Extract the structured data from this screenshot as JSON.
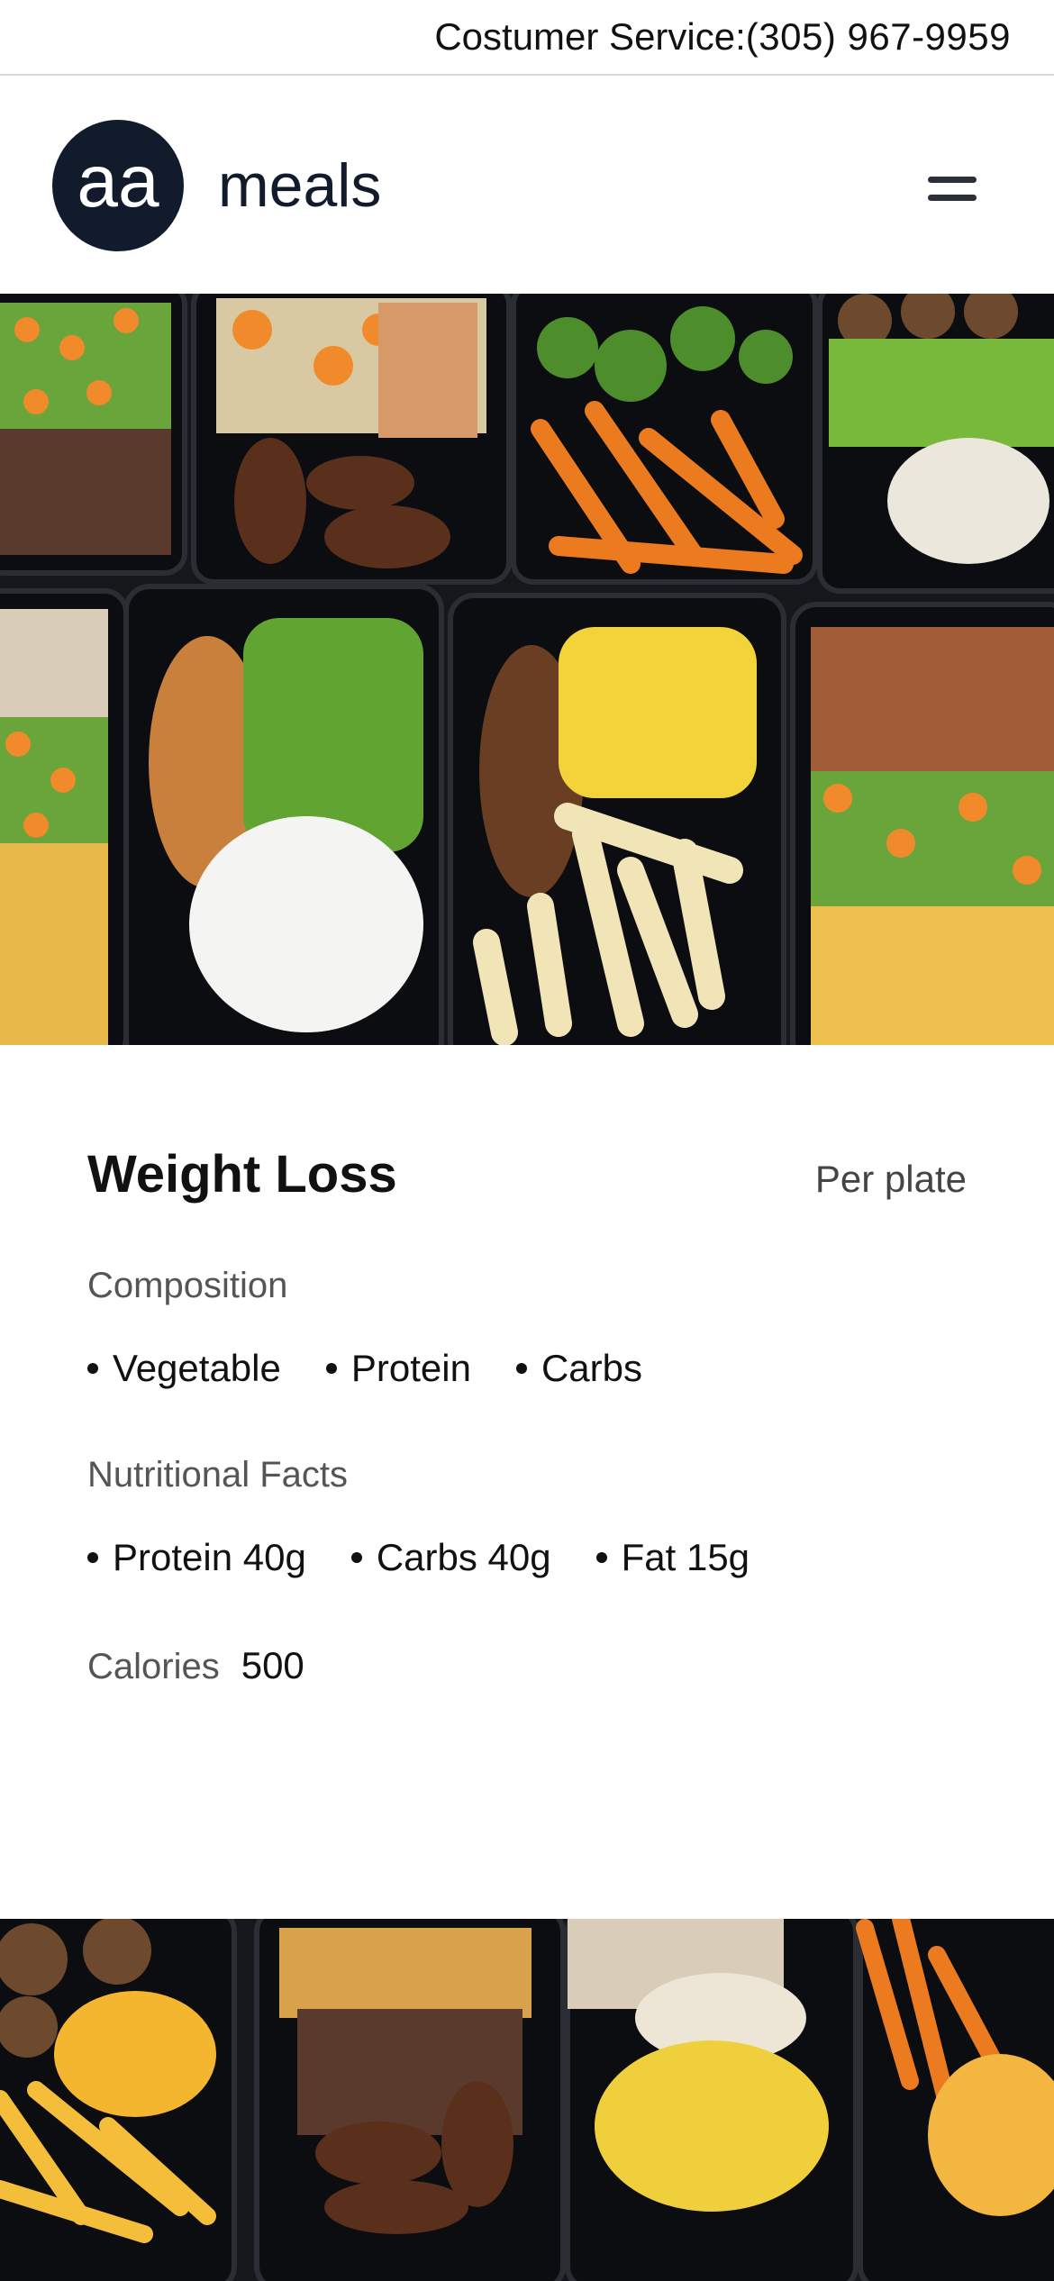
{
  "topbar": {
    "service_label": "Costumer Service:",
    "phone": "(305) 967-9959"
  },
  "header": {
    "logo_mark": "aa",
    "logo_text": "meals",
    "menu_icon": "hamburger-menu-icon"
  },
  "plan": {
    "title": "Weight Loss",
    "unit_label": "Per plate",
    "composition_label": "Composition",
    "composition": [
      "Vegetable",
      "Protein",
      "Carbs"
    ],
    "nutrition_label": "Nutritional Facts",
    "nutrition": [
      "Protein 40g",
      "Carbs 40g",
      "Fat 15g"
    ],
    "calories_label": "Calories",
    "calories_value": "500"
  },
  "colors": {
    "brand": "#111b2b",
    "tray": "#14161a"
  }
}
